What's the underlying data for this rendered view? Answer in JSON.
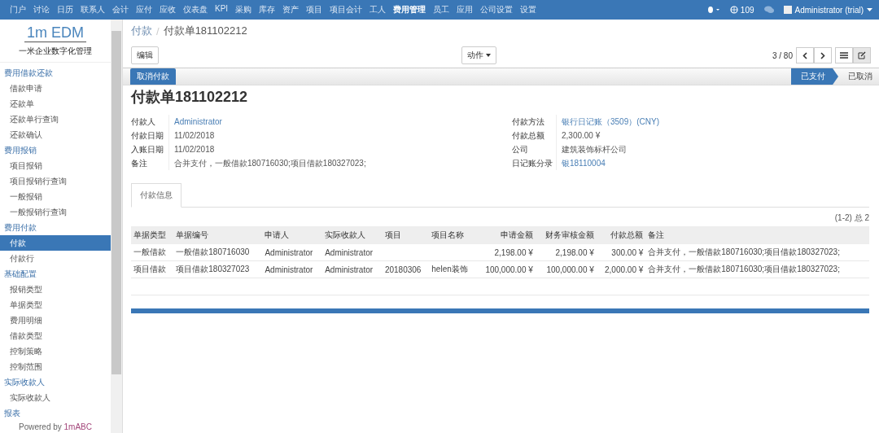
{
  "top_menu": [
    {
      "label": "门户",
      "selected": false
    },
    {
      "label": "讨论",
      "selected": false
    },
    {
      "label": "日历",
      "selected": false
    },
    {
      "label": "联系人",
      "selected": false
    },
    {
      "label": "会计",
      "selected": false
    },
    {
      "label": "应付",
      "selected": false
    },
    {
      "label": "应收",
      "selected": false
    },
    {
      "label": "仪表盘",
      "selected": false
    },
    {
      "label": "KPI",
      "selected": false
    },
    {
      "label": "采购",
      "selected": false
    },
    {
      "label": "库存",
      "selected": false
    },
    {
      "label": "资产",
      "selected": false
    },
    {
      "label": "项目",
      "selected": false
    },
    {
      "label": "项目会计",
      "selected": false
    },
    {
      "label": "工人",
      "selected": false
    },
    {
      "label": "费用管理",
      "selected": true
    },
    {
      "label": "员工",
      "selected": false
    },
    {
      "label": "应用",
      "selected": false
    },
    {
      "label": "公司设置",
      "selected": false
    },
    {
      "label": "设置",
      "selected": false
    }
  ],
  "top_right": {
    "message_count": "109",
    "user": "Administrator (trial)"
  },
  "logo": {
    "title": "1m EDM",
    "subtitle": "一米企业数字化管理"
  },
  "sidebar": [
    {
      "heading": "费用借款还款",
      "items": [
        {
          "label": "借款申请",
          "selected": false
        },
        {
          "label": "还款单",
          "selected": false
        },
        {
          "label": "还款单行查询",
          "selected": false
        },
        {
          "label": "还款确认",
          "selected": false
        }
      ]
    },
    {
      "heading": "费用报销",
      "items": [
        {
          "label": "项目报销",
          "selected": false
        },
        {
          "label": "项目报销行查询",
          "selected": false
        },
        {
          "label": "一般报销",
          "selected": false
        },
        {
          "label": "一般报销行查询",
          "selected": false
        }
      ]
    },
    {
      "heading": "费用付款",
      "items": [
        {
          "label": "付款",
          "selected": true
        },
        {
          "label": "付款行",
          "selected": false
        }
      ]
    },
    {
      "heading": "基础配置",
      "items": [
        {
          "label": "报销类型",
          "selected": false
        },
        {
          "label": "单据类型",
          "selected": false
        },
        {
          "label": "费用明细",
          "selected": false
        },
        {
          "label": "借款类型",
          "selected": false
        },
        {
          "label": "控制策略",
          "selected": false
        },
        {
          "label": "控制范围",
          "selected": false
        }
      ]
    },
    {
      "heading": "实际收款人",
      "items": [
        {
          "label": "实际收款人",
          "selected": false
        }
      ]
    },
    {
      "heading": "报表"
    }
  ],
  "powered_by": {
    "prefix": "Powered by",
    "brand": "1mABC"
  },
  "breadcrumb": [
    "付款",
    "/",
    "付款单181102212"
  ],
  "edit_button": "编辑",
  "action_button": "动作",
  "pager": "3 / 80",
  "cancel_payment_button": "取消付款",
  "statuses": [
    {
      "label": "已支付",
      "selected": true
    },
    {
      "label": "已取消",
      "selected": false
    }
  ],
  "record_title": "付款单181102212",
  "fields_left": [
    {
      "label": "付款人",
      "value": "Administrator",
      "kind": "link"
    },
    {
      "label": "付款日期",
      "value": "11/02/2018",
      "kind": "text"
    },
    {
      "label": "入账日期",
      "value": "11/02/2018",
      "kind": "text"
    },
    {
      "label": "备注",
      "value": "合并支付，一般借款180716030;项目借款180327023;",
      "kind": "text"
    }
  ],
  "fields_right": [
    {
      "label": "付款方法",
      "value": "银行日记账（3509）(CNY)",
      "kind": "link"
    },
    {
      "label": "付款总额",
      "value": "2,300.00 ¥",
      "kind": "text"
    },
    {
      "label": "公司",
      "value": "建筑装饰标杆公司",
      "kind": "text"
    },
    {
      "label": "日记账分录",
      "value": "银18110004",
      "kind": "link"
    }
  ],
  "tabs": [
    {
      "label": "付款信息",
      "selected": true
    }
  ],
  "table": {
    "count": "(1-2) 总 2",
    "columns": [
      "单据类型",
      "单据编号",
      "申请人",
      "实际收款人",
      "项目",
      "项目名称",
      "申请金额",
      "财务审核金额",
      "付款总额",
      "备注"
    ],
    "rows": [
      [
        "一般借款",
        "一般借款180716030",
        "Administrator",
        "Administrator",
        "",
        "",
        "2,198.00 ¥",
        "2,198.00 ¥",
        "300.00 ¥",
        "合并支付，一般借款180716030;项目借款180327023;"
      ],
      [
        "项目借款",
        "项目借款180327023",
        "Administrator",
        "Administrator",
        "20180306",
        "helen装饰",
        "100,000.00 ¥",
        "100,000.00 ¥",
        "2,000.00 ¥",
        "合并支付，一般借款180716030;项目借款180327023;"
      ]
    ]
  }
}
